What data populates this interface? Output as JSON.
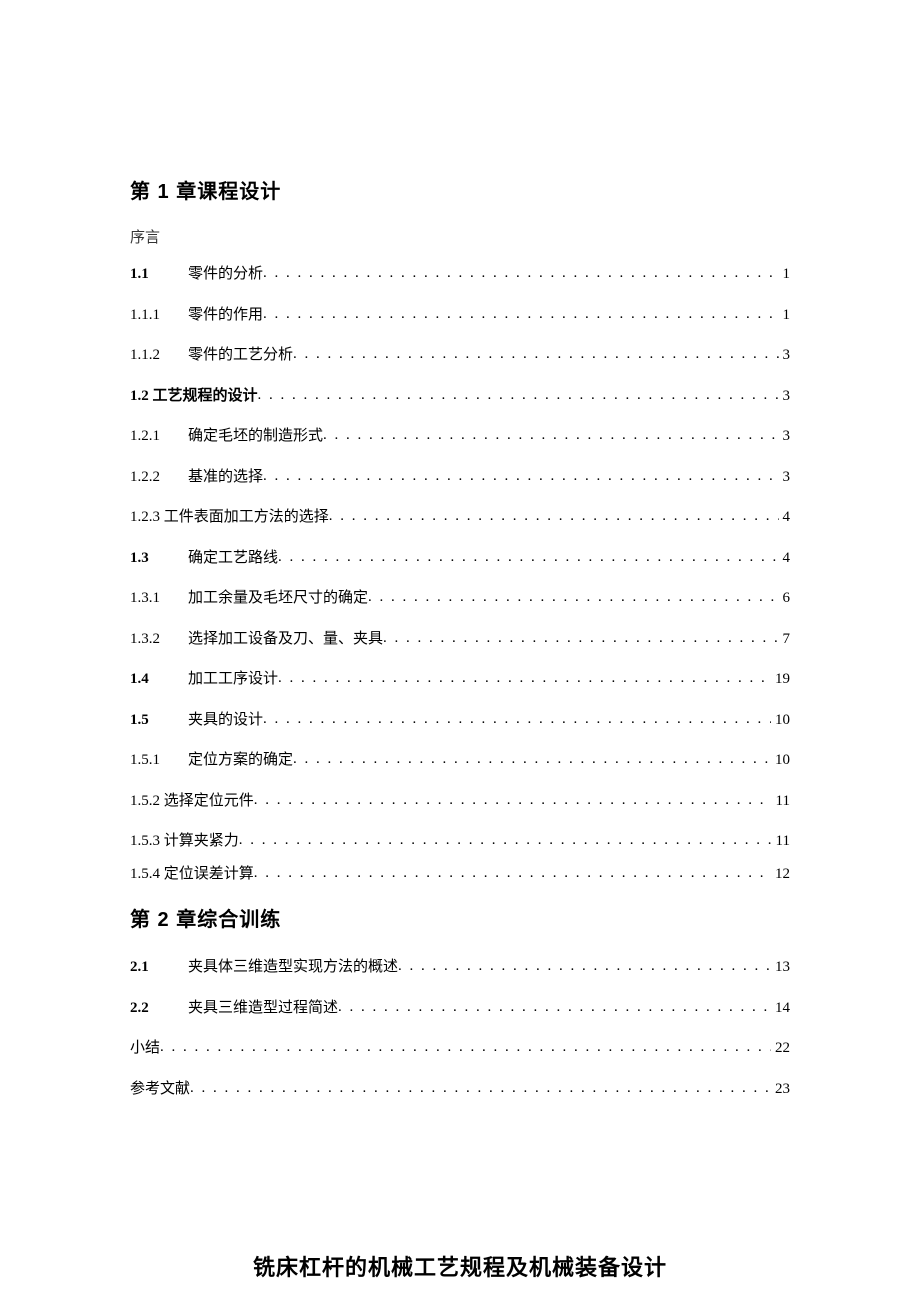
{
  "chapter1_heading": "第 1 章课程设计",
  "preface": "序言",
  "toc": [
    {
      "num": "1.1",
      "title": "零件的分析",
      "page": "1",
      "bold_num": true,
      "indent": true
    },
    {
      "num": "1.1.1",
      "title": "零件的作用",
      "page": "1",
      "indent": true,
      "space_after_title": true
    },
    {
      "num": "1.1.2",
      "title": "零件的工艺分析",
      "page": "3",
      "indent": true,
      "space_after_title": true
    },
    {
      "num": "",
      "title": "1.2 工艺规程的设计",
      "page": "3",
      "bold_title": true,
      "indent": false,
      "space_after_title": true
    },
    {
      "num": "1.2.1",
      "title": "确定毛坯的制造形式",
      "page": "3",
      "indent": true,
      "space_after_title": true
    },
    {
      "num": "1.2.2",
      "title": "基准的选择",
      "page": "3",
      "indent": true,
      "space_after_title": true
    },
    {
      "num": "",
      "title": "1.2.3 工件表面加工方法的选择",
      "page": "4",
      "indent": false
    },
    {
      "num": "1.3",
      "title": "确定工艺路线",
      "page": "4",
      "bold_num": true,
      "indent": true
    },
    {
      "num": "1.3.1",
      "title": "加工余量及毛坯尺寸的确定",
      "page": "6",
      "indent": true,
      "space_after_title": true
    },
    {
      "num": "1.3.2",
      "title": "选择加工设备及刀、量、夹具",
      "page": "7",
      "indent": true,
      "space_after_title": true
    },
    {
      "num": "1.4",
      "title": "加工工序设计",
      "page": "19",
      "bold_num": true,
      "indent": true
    },
    {
      "num": "1.5",
      "title": "夹具的设计",
      "page": "10",
      "bold_num": true,
      "indent": true
    },
    {
      "num": "1.5.1",
      "title": "定位方案的确定",
      "page": "10",
      "indent": true,
      "space_after_title": true
    },
    {
      "num": "",
      "title": "1.5.2 选择定位元件",
      "page": "11",
      "indent": false
    },
    {
      "num": "",
      "title": "1.5.3 计算夹紧力",
      "page": "11",
      "indent": false,
      "tight": true
    },
    {
      "num": "",
      "title": "1.5.4 定位误差计算",
      "page": "12",
      "indent": false
    }
  ],
  "chapter2_heading": "第 2 章综合训练",
  "toc2": [
    {
      "num": "2.1",
      "title": "夹具体三维造型实现方法的概述",
      "page": "13",
      "bold_num": true,
      "indent": true
    },
    {
      "num": "2.2",
      "title": "夹具三维造型过程简述",
      "page": "14",
      "bold_num": true,
      "indent": true
    },
    {
      "num": "",
      "title": "小结",
      "page": "22",
      "indent": false,
      "space_after_title": true
    },
    {
      "num": "",
      "title": "参考文献",
      "page": "23",
      "indent": false,
      "space_after_title": true
    }
  ],
  "doc_title": "铣床杠杆的机械工艺规程及机械装备设计"
}
